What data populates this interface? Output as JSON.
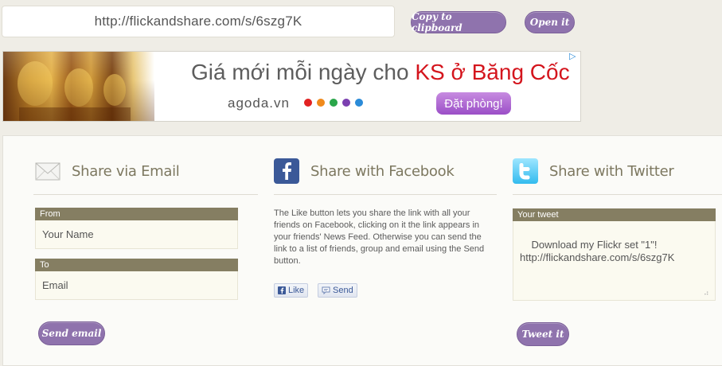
{
  "top": {
    "url": "http://flickandshare.com/s/6szg7K",
    "copy_label": "Copy to clipboard",
    "open_label": "Open it"
  },
  "ad": {
    "headline_prefix": "Giá mới mỗi ngày cho ",
    "headline_red": "KS ở Băng Cốc",
    "domain": "agoda.vn",
    "cta": "Đặt phòng!",
    "dot_colors": [
      "#e22222",
      "#f08a1c",
      "#2aa64a",
      "#7b3fb0",
      "#2b8bd8"
    ]
  },
  "email": {
    "title": "Share via Email",
    "from_label": "From",
    "from_placeholder": "Your Name",
    "to_label": "To",
    "to_placeholder": "Email",
    "send_label": "Send email"
  },
  "facebook": {
    "title": "Share with Facebook",
    "description": "The Like button lets you share the link with all your friends on Facebook, clicking on it the link appears in your friends' News Feed. Otherwise you can send the link to a list of friends, group and email using the Send button.",
    "like_label": "Like",
    "send_label": "Send"
  },
  "twitter": {
    "title": "Share with Twitter",
    "field_label": "Your tweet",
    "tweet_text": "Download my Flickr set \"1\"!\nhttp://flickandshare.com/s/6szg7K",
    "tweet_label": "Tweet it"
  },
  "colors": {
    "accent_button": "#8f73ad",
    "label_bar": "#857e62",
    "heading": "#7d7860",
    "facebook_blue": "#3b5998",
    "twitter_blue": "#33ccff"
  }
}
